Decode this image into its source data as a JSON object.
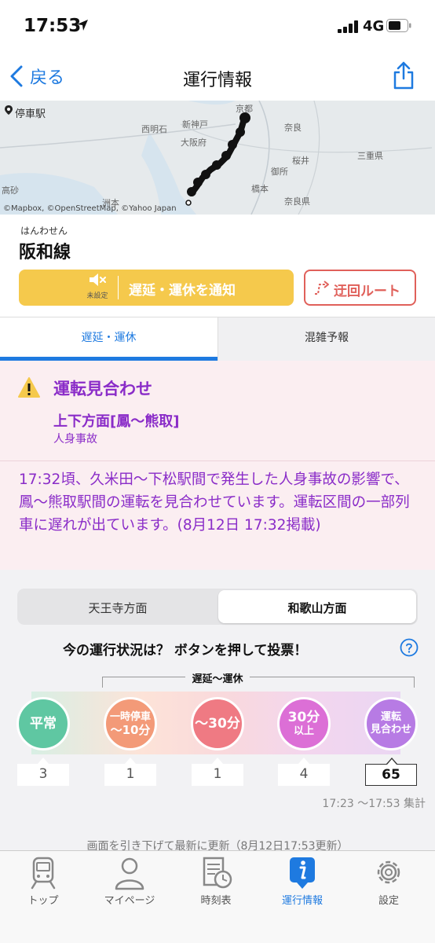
{
  "status_bar": {
    "time": "17:53",
    "network": "4G"
  },
  "nav": {
    "back_label": "戻る",
    "title": "運行情報"
  },
  "map": {
    "stop_label": "停車駅",
    "attribution": "©Mapbox, ©OpenStreetMap, ©Yahoo Japan",
    "places": [
      "新神戸",
      "大阪府",
      "京都",
      "奈良",
      "三重県",
      "奈良県",
      "西明石",
      "高砂",
      "洲本",
      "桜井",
      "御所",
      "橋本"
    ]
  },
  "line": {
    "kana": "はんわせん",
    "name": "阪和線"
  },
  "notify": {
    "mute_sub": "未設定",
    "label": "遅延・運休を通知"
  },
  "detour": {
    "label": "迂回ルート"
  },
  "tabs": {
    "delay": "遅延・運休",
    "congestion": "混雑予報"
  },
  "alert": {
    "status": "運転見合わせ",
    "direction": "上下方面[鳳〜熊取]",
    "cause": "人身事故",
    "message": "17:32頃、久米田〜下松駅間で発生した人身事故の影響で、鳳〜熊取駅間の運転を見合わせています。運転区間の一部列車に遅れが出ています。(8月12日 17:32掲載)"
  },
  "vote": {
    "direction_options": [
      "天王寺方面",
      "和歌山方面"
    ],
    "selected_direction": "和歌山方面",
    "question": "今の運行状況は？ ボタンを押して投票！",
    "bracket_label": "遅延〜運休",
    "options": [
      {
        "line1": "平常",
        "line2": "",
        "count": "3",
        "color": "#5fc7a2"
      },
      {
        "line1": "一時停車",
        "line2": "〜10分",
        "count": "1",
        "color": "#f39a78"
      },
      {
        "line1": "〜30分",
        "line2": "",
        "count": "1",
        "color": "#ef7a83"
      },
      {
        "line1": "30分",
        "line2": "以上",
        "count": "4",
        "color": "#dc6fd6"
      },
      {
        "line1": "運転",
        "line2": "見合わせ",
        "count": "65",
        "color": "#b77be4"
      }
    ],
    "period": "17:23 〜17:53 集計"
  },
  "refresh_note": "画面を引き下げて最新に更新（8月12日17:53更新）",
  "tabbar": {
    "items": [
      {
        "label": "トップ",
        "icon": "train-icon"
      },
      {
        "label": "マイページ",
        "icon": "person-icon"
      },
      {
        "label": "時刻表",
        "icon": "timetable-icon"
      },
      {
        "label": "運行情報",
        "icon": "info-icon"
      },
      {
        "label": "設定",
        "icon": "gear-icon"
      }
    ],
    "active": "運行情報"
  },
  "colors": {
    "accent": "#1e7ae0",
    "alert_text": "#8a2cc8",
    "notify_bg": "#f5c94c",
    "detour": "#e0605a"
  }
}
